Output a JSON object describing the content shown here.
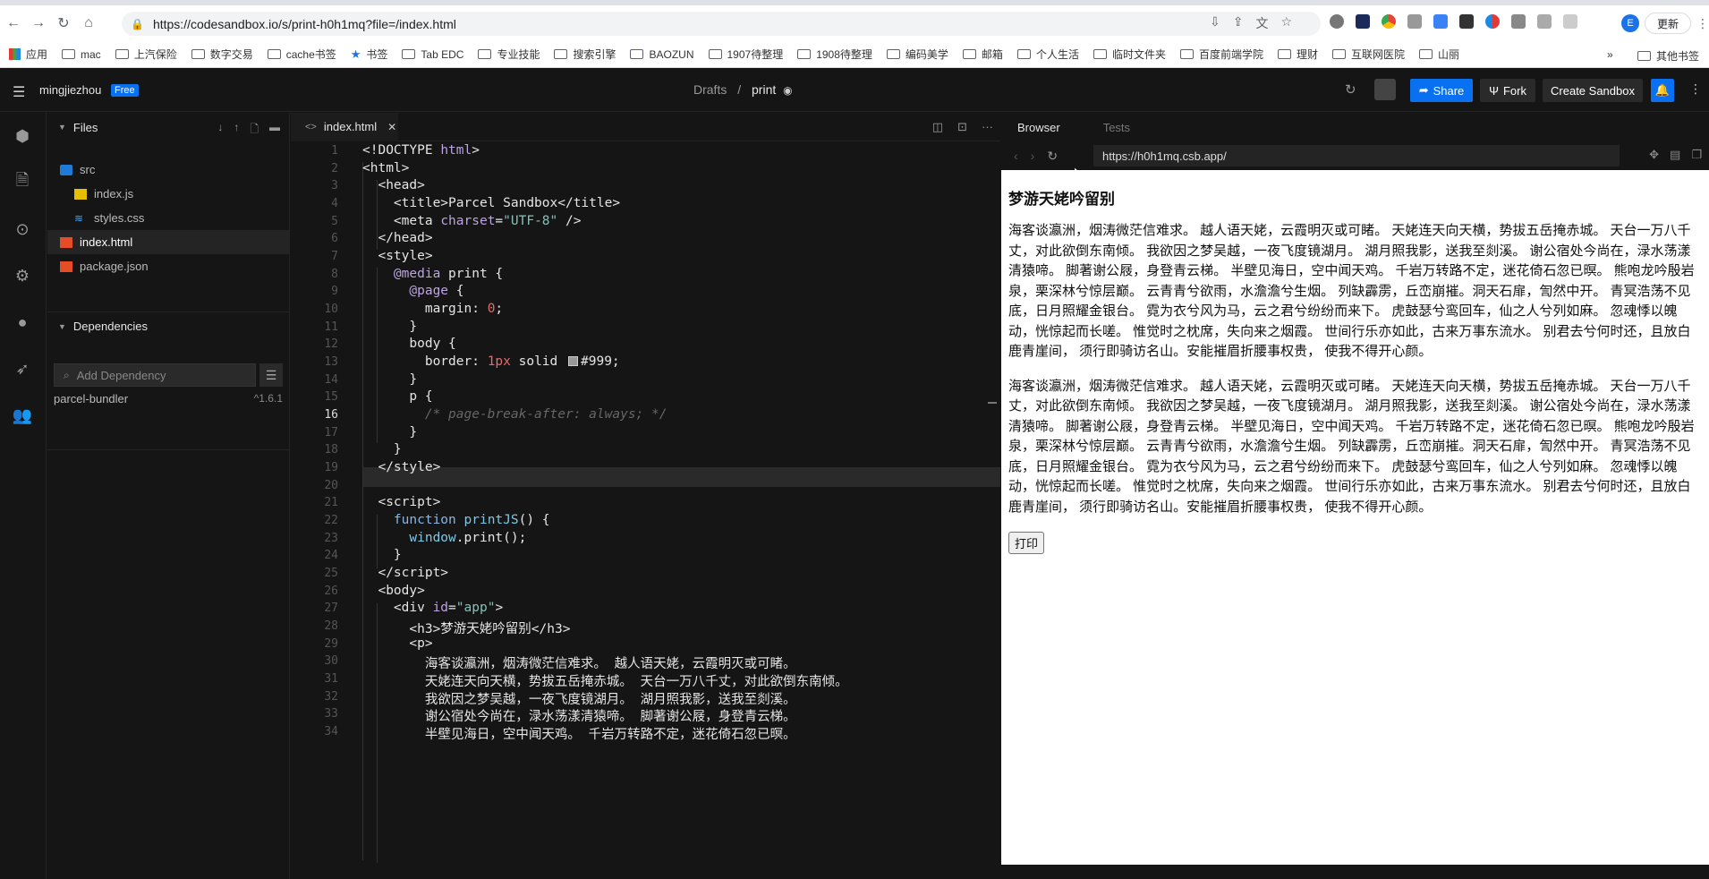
{
  "browser": {
    "url": "https://codesandbox.io/s/print-h0h1mq?file=/index.html",
    "update_label": "更新",
    "profile_initial": "E",
    "bookmarks": [
      "应用",
      "mac",
      "上汽保险",
      "数字交易",
      "cache书签",
      "书签",
      "Tab EDC",
      "专业技能",
      "搜索引擎",
      "BAOZUN",
      "1907待整理",
      "1908待整理",
      "编码美学",
      "邮箱",
      "个人生活",
      "临时文件夹",
      "百度前端学院",
      "理财",
      "互联网医院",
      "山丽"
    ],
    "bookmarks_more": "»",
    "bookmarks_other": "其他书签"
  },
  "header": {
    "username": "mingjiezhou",
    "badge": "Free",
    "crumb_root": "Drafts",
    "crumb_sep": "/",
    "crumb_current": "print",
    "share_label": "Share",
    "fork_label": "Fork",
    "create_label": "Create Sandbox"
  },
  "sidebar": {
    "files_title": "Files",
    "files": [
      {
        "name": "src",
        "type": "folder"
      },
      {
        "name": "index.js",
        "type": "js"
      },
      {
        "name": "styles.css",
        "type": "css"
      },
      {
        "name": "index.html",
        "type": "html"
      },
      {
        "name": "package.json",
        "type": "json"
      }
    ],
    "deps_title": "Dependencies",
    "add_dep_placeholder": "Add Dependency",
    "deps": [
      {
        "name": "parcel-bundler",
        "version": "^1.6.1"
      }
    ]
  },
  "editor": {
    "tab_label": "index.html",
    "current_line": 16,
    "line_numbers": [
      "1",
      "2",
      "3",
      "4",
      "5",
      "6",
      "7",
      "8",
      "9",
      "10",
      "11",
      "12",
      "13",
      "14",
      "15",
      "16",
      "17",
      "18",
      "19",
      "20",
      "21",
      "22",
      "23",
      "24",
      "25",
      "26",
      "27",
      "28",
      "29",
      "30",
      "31",
      "32",
      "33",
      "34"
    ]
  },
  "preview": {
    "tab_browser": "Browser",
    "tab_tests": "Tests",
    "url": "https://h0h1mq.csb.app/",
    "title": "梦游天姥吟留别",
    "paragraph": "海客谈瀛洲，烟涛微茫信难求。 越人语天姥，云霞明灭或可睹。 天姥连天向天横，势拔五岳掩赤城。 天台一万八千丈，对此欲倒东南倾。 我欲因之梦吴越，一夜飞度镜湖月。 湖月照我影，送我至剡溪。 谢公宿处今尚在，渌水荡漾清猿啼。 脚著谢公屐，身登青云梯。 半壁见海日，空中闻天鸡。 千岩万转路不定，迷花倚石忽已暝。 熊咆龙吟殷岩泉，栗深林兮惊层巅。 云青青兮欲雨，水澹澹兮生烟。 列缺霹雳，丘峦崩摧。洞天石扉，訇然中开。 青冥浩荡不见底，日月照耀金银台。 霓为衣兮风为马，云之君兮纷纷而来下。 虎鼓瑟兮鸾回车，仙之人兮列如麻。 忽魂悸以魄动，恍惊起而长嗟。 惟觉时之枕席，失向来之烟霞。 世间行乐亦如此，古来万事东流水。 别君去兮何时还，且放白鹿青崖间， 须行即骑访名山。安能摧眉折腰事权贵， 使我不得开心颜。",
    "print_button": "打印"
  },
  "colors": {
    "accent": "#0971f1",
    "editor_bg": "#151515"
  }
}
